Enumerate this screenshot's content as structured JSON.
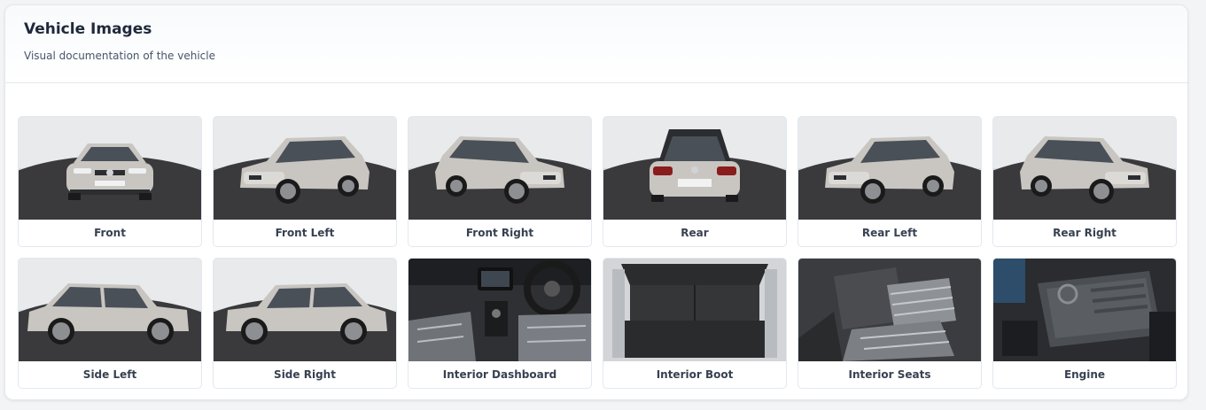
{
  "header": {
    "title": "Vehicle Images",
    "subtitle": "Visual documentation of the vehicle"
  },
  "images": [
    {
      "label": "Front",
      "name": "front",
      "kind": "car-front"
    },
    {
      "label": "Front Left",
      "name": "front-left",
      "kind": "car-front-left"
    },
    {
      "label": "Front Right",
      "name": "front-right",
      "kind": "car-front-right"
    },
    {
      "label": "Rear",
      "name": "rear",
      "kind": "car-rear"
    },
    {
      "label": "Rear Left",
      "name": "rear-left",
      "kind": "car-rear-left"
    },
    {
      "label": "Rear Right",
      "name": "rear-right",
      "kind": "car-rear-right"
    },
    {
      "label": "Side Left",
      "name": "side-left",
      "kind": "car-side-left"
    },
    {
      "label": "Side Right",
      "name": "side-right",
      "kind": "car-side-right"
    },
    {
      "label": "Interior Dashboard",
      "name": "interior-dashboard",
      "kind": "dashboard"
    },
    {
      "label": "Interior Boot",
      "name": "interior-boot",
      "kind": "boot"
    },
    {
      "label": "Interior Seats",
      "name": "interior-seats",
      "kind": "seats"
    },
    {
      "label": "Engine",
      "name": "engine",
      "kind": "engine"
    }
  ]
}
